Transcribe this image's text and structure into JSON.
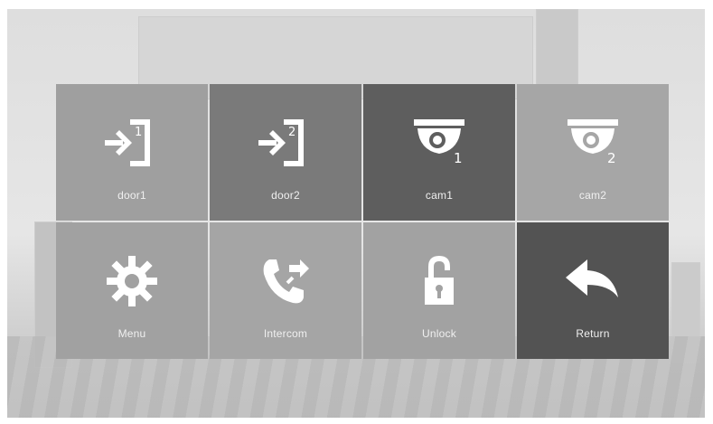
{
  "tiles": [
    {
      "label": "door1",
      "icon": "door-enter-icon",
      "index": "1"
    },
    {
      "label": "door2",
      "icon": "door-enter-icon",
      "index": "2"
    },
    {
      "label": "cam1",
      "icon": "dome-camera-icon",
      "index": "1"
    },
    {
      "label": "cam2",
      "icon": "dome-camera-icon",
      "index": "2"
    },
    {
      "label": "Menu",
      "icon": "gear-icon"
    },
    {
      "label": "Intercom",
      "icon": "phone-transfer-icon"
    },
    {
      "label": "Unlock",
      "icon": "unlock-icon"
    },
    {
      "label": "Return",
      "icon": "return-arrow-icon"
    }
  ],
  "colors": {
    "icon": "#ffffff",
    "label": "#f0f0f0"
  }
}
